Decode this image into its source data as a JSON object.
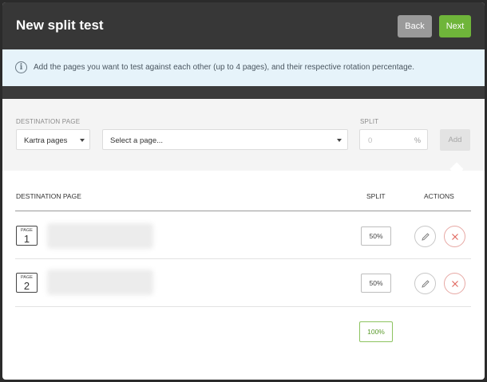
{
  "header": {
    "title": "New split test",
    "back_label": "Back",
    "next_label": "Next"
  },
  "info": {
    "text": "Add the pages you want to test against each other (up to 4 pages), and their respective rotation percentage.",
    "icon": "info-icon"
  },
  "form": {
    "destination_label": "DESTINATION PAGE",
    "split_label": "SPLIT",
    "source_select": "Kartra pages",
    "page_select_placeholder": "Select a page...",
    "split_placeholder": "0",
    "percent_symbol": "%",
    "add_label": "Add"
  },
  "table": {
    "headers": {
      "destination": "DESTINATION PAGE",
      "split": "SPLIT",
      "actions": "ACTIONS"
    },
    "rows": [
      {
        "page_label": "PAGE",
        "page_number": "1",
        "split": "50%"
      },
      {
        "page_label": "PAGE",
        "page_number": "2",
        "split": "50%"
      }
    ],
    "total": "100%"
  },
  "colors": {
    "header_bg": "#373737",
    "next_green": "#6fb53a",
    "info_bg": "#e6f3fa",
    "delete_red": "#e0645c"
  }
}
